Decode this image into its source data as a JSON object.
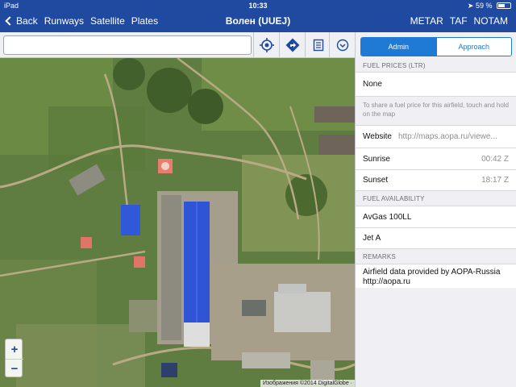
{
  "status": {
    "device": "iPad",
    "time": "10:33",
    "battery": "59 %",
    "battery_level": 0.59
  },
  "nav": {
    "back": "Back",
    "runways": "Runways",
    "satellite": "Satellite",
    "plates": "Plates",
    "title": "Волен (UUEJ)",
    "metar": "METAR",
    "taf": "TAF",
    "notam": "NOTAM"
  },
  "toolbar": {
    "search_value": "",
    "search_placeholder": ""
  },
  "map": {
    "attribution": "Изображения ©2014 DigitalGlobe ·",
    "zoom_in": "+",
    "zoom_out": "−"
  },
  "panel": {
    "tabs": {
      "admin": "Admin",
      "approach": "Approach",
      "active": "admin"
    },
    "fuel_prices_header": "FUEL PRICES (LTR)",
    "fuel_price_value": "None",
    "fuel_note": "To share a fuel price for this airfield, touch and hold on the map",
    "website_label": "Website",
    "website_value": "http://maps.aopa.ru/viewe...",
    "sunrise_label": "Sunrise",
    "sunrise_value": "00:42 Z",
    "sunset_label": "Sunset",
    "sunset_value": "18:17 Z",
    "fuel_availability_header": "FUEL AVAILABILITY",
    "fuel_types": [
      "AvGas 100LL",
      "Jet A"
    ],
    "remarks_header": "REMARKS",
    "remarks_text": "Airfield data provided by AOPA-Russia http://aopa.ru"
  },
  "colors": {
    "bar": "#1f4aa0",
    "accent": "#1f7ad6",
    "roof": "#2f55d6"
  }
}
